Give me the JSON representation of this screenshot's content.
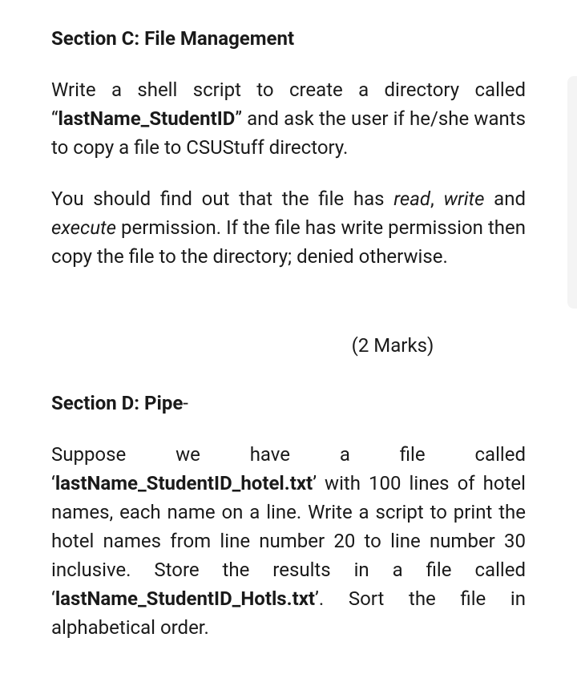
{
  "sectionC": {
    "heading": "Section C: File Management",
    "para1_part1": "Write a shell script to create a directory called “",
    "para1_bold": "lastName_StudentID",
    "para1_part2": "” and ask the user if he/she wants to copy a file to CSUStuff directory.",
    "para2_part1": "You should find out that the file has ",
    "para2_read": "read",
    "para2_sep1": ", ",
    "para2_write": "write",
    "para2_sep2": " and ",
    "para2_execute": "execute",
    "para2_part2": " permission. If the file has write permission then copy the file to the directory; denied otherwise.",
    "marks": "(2 Marks)"
  },
  "sectionD": {
    "heading_bold": "Section D: Pipe",
    "heading_dash": "-",
    "para1_part1": "Suppose we have a file called ‘",
    "para1_bold1": "lastName_StudentID_hotel.txt",
    "para1_part2": "’ with 100 lines of hotel names, each name on a line.  Write a script to print the hotel names from line number 20 to line number 30 inclusive. Store the results in a file called ‘",
    "para1_bold2": "lastName_StudentID_Hotls.txt",
    "para1_part3": "’. Sort the file in alphabetical order."
  }
}
